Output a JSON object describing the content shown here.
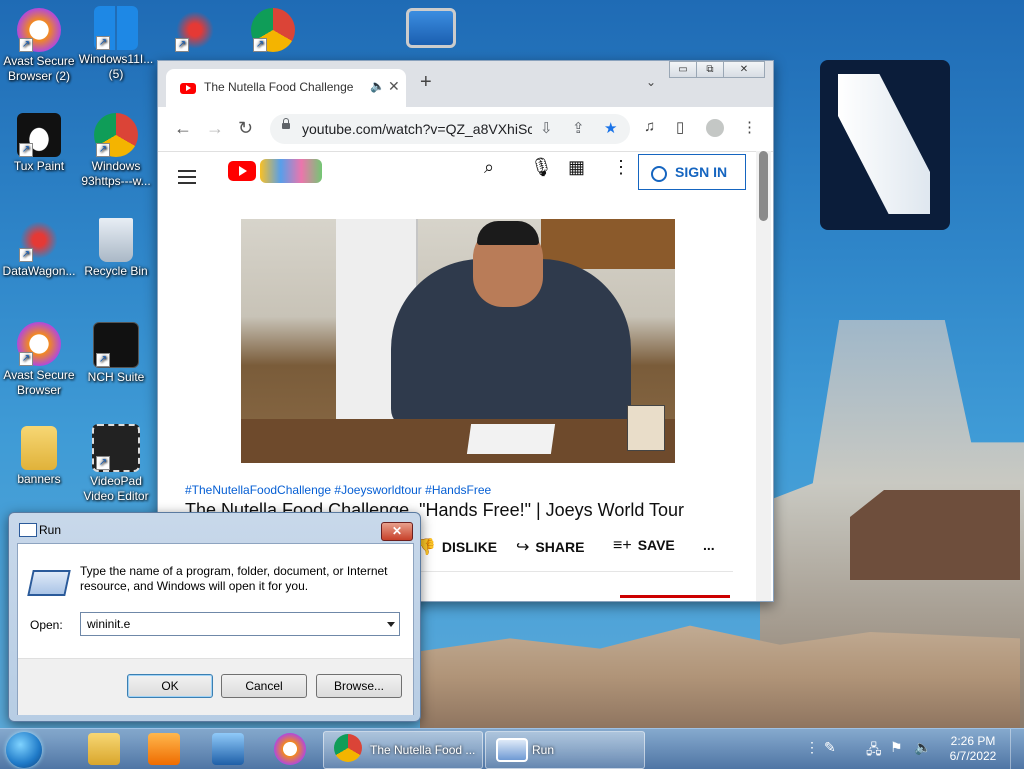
{
  "desktop": {
    "icons": [
      {
        "label": "Avast Secure Browser (2)",
        "icon": "avast-browser-icon"
      },
      {
        "label": "Windows11I... (5)",
        "icon": "windows-shield-icon"
      },
      {
        "label": "",
        "icon": "datawagon-icon"
      },
      {
        "label": "",
        "icon": "chrome-icon"
      },
      {
        "label": "",
        "icon": "computer-icon"
      },
      {
        "label": "Tux Paint",
        "icon": "tux-paint-icon"
      },
      {
        "label": "Windows 93https---w...",
        "icon": "chrome-icon"
      },
      {
        "label": "DataWagon...",
        "icon": "datawagon-icon"
      },
      {
        "label": "Recycle Bin",
        "icon": "recycle-bin-icon"
      },
      {
        "label": "Avast Secure Browser",
        "icon": "avast-browser-icon"
      },
      {
        "label": "NCH Suite",
        "icon": "nch-suite-icon"
      },
      {
        "label": "banners",
        "icon": "folder-icon"
      },
      {
        "label": "VideoPad Video Editor",
        "icon": "videopad-icon"
      }
    ]
  },
  "chrome": {
    "tab_title": "The Nutella Food Challenge",
    "close_tab": "✕",
    "new_tab": "+",
    "tab_search": "⌄",
    "url": "youtube.com/watch?v=QZ_a8VXhiSc",
    "window_buttons": {
      "minimize": "▭",
      "maximize": "⧉",
      "close": "✕"
    }
  },
  "youtube": {
    "signin": "SIGN IN",
    "hashtags": "#TheNutellaFoodChallenge #Joeysworldtour #HandsFree",
    "video_title": "The Nutella Food Challenge, \"Hands Free!\" | Joeys World Tour",
    "actions": {
      "dislike": "DISLIKE",
      "share": "SHARE",
      "save": "SAVE",
      "more": "..."
    }
  },
  "run_dialog": {
    "title": "Run",
    "close": "✕",
    "description": "Type the name of a program, folder, document, or Internet resource, and Windows will open it for you.",
    "open_label": "Open:",
    "open_value": "wininit.e",
    "ok": "OK",
    "cancel": "Cancel",
    "browse": "Browse..."
  },
  "taskbar": {
    "tasks": [
      {
        "label": "The Nutella Food ...",
        "icon": "chrome-icon"
      },
      {
        "label": "Run",
        "icon": "run-icon"
      }
    ],
    "time": "2:26 PM",
    "date": "6/7/2022"
  }
}
